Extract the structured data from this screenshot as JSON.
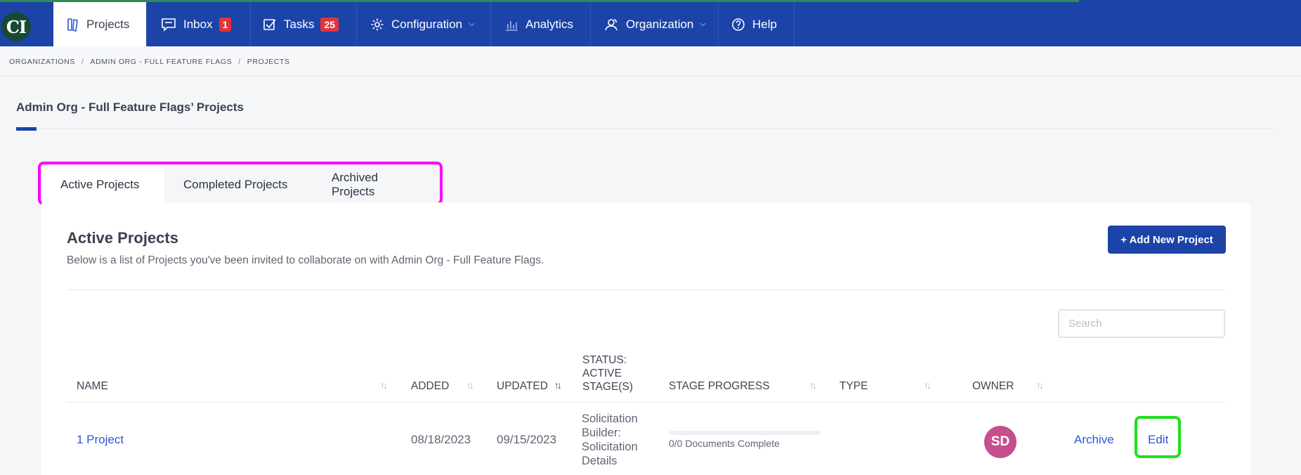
{
  "nav": {
    "logo_text": "CI",
    "items": [
      {
        "label": "Projects",
        "icon": "projects-icon",
        "active": true
      },
      {
        "label": "Inbox",
        "icon": "inbox-icon",
        "badge": "1"
      },
      {
        "label": "Tasks",
        "icon": "tasks-checkbox-icon",
        "badge": "25"
      },
      {
        "label": "Configuration",
        "icon": "gear-icon",
        "dropdown": true
      },
      {
        "label": "Analytics",
        "icon": "bar-chart-icon"
      },
      {
        "label": "Organization",
        "icon": "users-icon",
        "dropdown": true
      },
      {
        "label": "Help",
        "icon": "help-circle-icon"
      }
    ],
    "colors": {
      "bar": "#1c43a8",
      "badge": "#e3333b"
    }
  },
  "breadcrumb": {
    "items": [
      "ORGANIZATIONS",
      "ADMIN ORG - FULL FEATURE FLAGS",
      "PROJECTS"
    ],
    "separator": "/"
  },
  "page": {
    "title": "Admin Org - Full Feature Flags’ Projects"
  },
  "tabs": [
    {
      "label": "Active Projects",
      "active": true
    },
    {
      "label": "Completed Projects"
    },
    {
      "label": "Archived Projects"
    }
  ],
  "card": {
    "title": "Active Projects",
    "subtitle": "Below is a list of Projects you've been invited to collaborate on with Admin Org - Full Feature Flags.",
    "add_button_label": "+ Add New Project",
    "search_placeholder": "Search"
  },
  "table": {
    "headers": {
      "name": "NAME",
      "added": "ADDED",
      "updated": "UPDATED",
      "status_line1": "STATUS:",
      "status_line2": "ACTIVE",
      "status_line3": "STAGE(S)",
      "stage_progress": "STAGE PROGRESS",
      "type": "TYPE",
      "owner": "OWNER"
    },
    "rows": [
      {
        "name": "1 Project",
        "added": "08/18/2023",
        "updated": "09/15/2023",
        "stage_lines": [
          "Solicitation",
          "Builder:",
          "Solicitation",
          "Details"
        ],
        "progress_fraction": 0,
        "progress_label": "0/0 Documents Complete",
        "type": "",
        "owner_initials": "SD",
        "archive_label": "Archive",
        "edit_label": "Edit"
      }
    ]
  }
}
